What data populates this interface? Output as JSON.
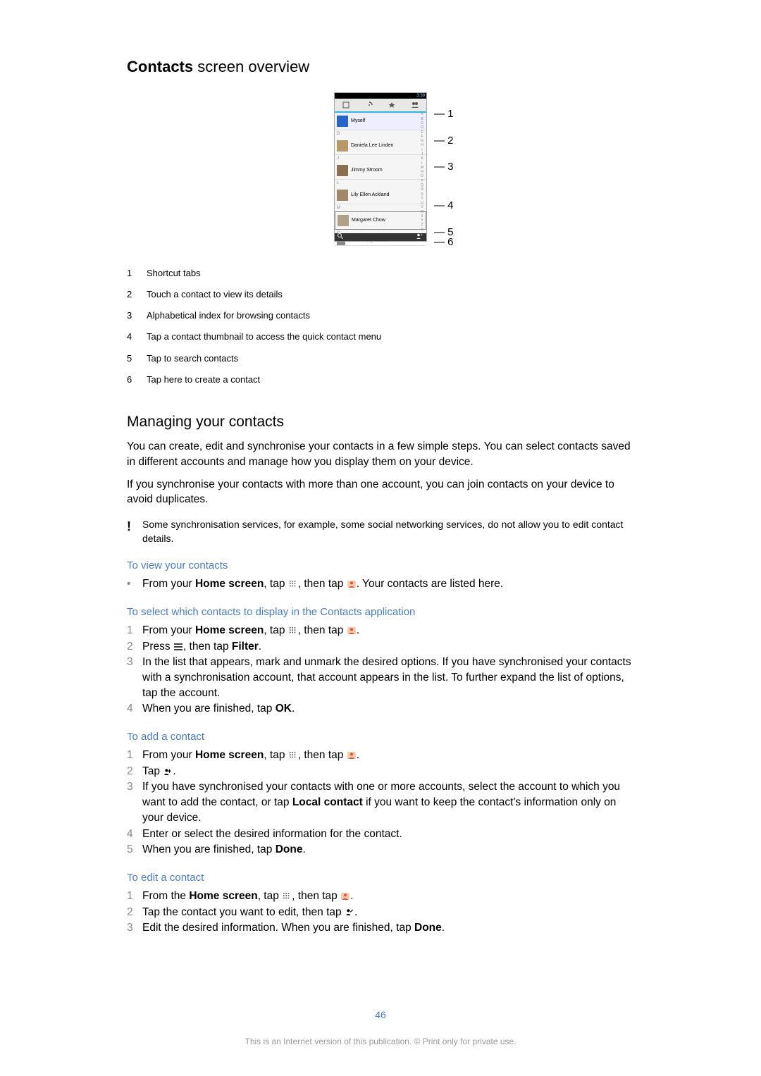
{
  "title_bold": "Contacts",
  "title_rest": " screen overview",
  "phone": {
    "status_time": "3:39",
    "myself": "Myself",
    "names": [
      "Daniela Lee Linden",
      "Jimmy Stroom",
      "Lily Ellen Ackland",
      "Margaret Chow",
      "Oliver Andy Szabo"
    ],
    "seps": [
      "D",
      "J",
      "L",
      "M",
      "O"
    ],
    "index_letters": [
      "A",
      "B",
      "C",
      "D",
      "E",
      "F",
      "G",
      "H",
      "I",
      "J",
      "K",
      "L",
      "M",
      "N",
      "O",
      "P",
      "Q",
      "R",
      "S",
      "T",
      "U",
      "V",
      "W",
      "X",
      "Y",
      "Z",
      "#"
    ]
  },
  "callouts": [
    "1",
    "2",
    "3",
    "4",
    "5",
    "6"
  ],
  "legend": [
    {
      "n": "1",
      "t": "Shortcut tabs"
    },
    {
      "n": "2",
      "t": "Touch a contact to view its details"
    },
    {
      "n": "3",
      "t": "Alphabetical index for browsing contacts"
    },
    {
      "n": "4",
      "t": "Tap a contact thumbnail to access the quick contact menu"
    },
    {
      "n": "5",
      "t": "Tap to search contacts"
    },
    {
      "n": "6",
      "t": "Tap here to create a contact"
    }
  ],
  "managing": {
    "heading": "Managing your contacts",
    "p1": "You can create, edit and synchronise your contacts in a few simple steps. You can select contacts saved in different accounts and manage how you display them on your device.",
    "p2": "If you synchronise your contacts with more than one account, you can join contacts on your device to avoid duplicates.",
    "note": "Some synchronisation services, for example, some social networking services, do not allow you to edit contact details."
  },
  "sections": {
    "view": {
      "h": "To view your contacts",
      "s1a": "From your ",
      "s1b": "Home screen",
      "s1c": ", tap ",
      "s1d": ", then tap ",
      "s1e": ". Your contacts are listed here."
    },
    "display": {
      "h": "To select which contacts to display in the Contacts application",
      "s1a": "From your ",
      "s1b": "Home screen",
      "s1c": ", tap ",
      "s1d": ", then tap ",
      "s1e": ".",
      "s2a": "Press ",
      "s2b": ", then tap ",
      "s2c": "Filter",
      "s2d": ".",
      "s3": "In the list that appears, mark and unmark the desired options. If you have synchronised your contacts with a synchronisation account, that account appears in the list. To further expand the list of options, tap the account.",
      "s4a": "When you are finished, tap ",
      "s4b": "OK",
      "s4c": "."
    },
    "add": {
      "h": "To add a contact",
      "s1a": "From your ",
      "s1b": "Home screen",
      "s1c": ", tap ",
      "s1d": ", then tap ",
      "s1e": ".",
      "s2a": "Tap ",
      "s2b": ".",
      "s3a": "If you have synchronised your contacts with one or more accounts, select the account to which you want to add the contact, or tap ",
      "s3b": "Local contact",
      "s3c": " if you want to keep the contact's information only on your device.",
      "s4": "Enter or select the desired information for the contact.",
      "s5a": "When you are finished, tap ",
      "s5b": "Done",
      "s5c": "."
    },
    "edit": {
      "h": "To edit a contact",
      "s1a": "From the ",
      "s1b": "Home screen",
      "s1c": ", tap ",
      "s1d": ", then tap ",
      "s1e": ".",
      "s2a": "Tap the contact you want to edit, then tap ",
      "s2b": ".",
      "s3a": "Edit the desired information. When you are finished, tap ",
      "s3b": "Done",
      "s3c": "."
    }
  },
  "page_number": "46",
  "footer": "This is an Internet version of this publication. © Print only for private use."
}
